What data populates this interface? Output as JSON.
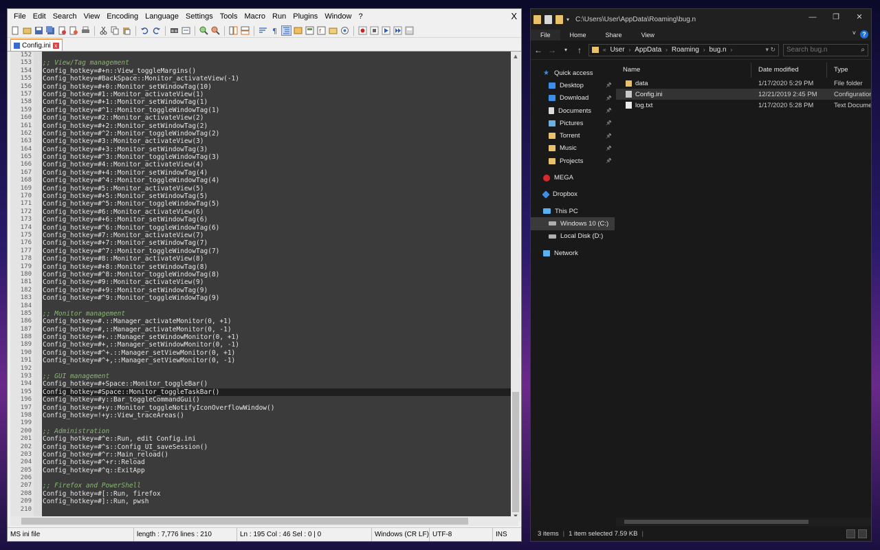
{
  "npp": {
    "menu": [
      "File",
      "Edit",
      "Search",
      "View",
      "Encoding",
      "Language",
      "Settings",
      "Tools",
      "Macro",
      "Run",
      "Plugins",
      "Window",
      "?"
    ],
    "close": "X",
    "tab": {
      "label": "Config.ini",
      "close": "x"
    },
    "code": [
      {
        "n": "152",
        "t": ""
      },
      {
        "n": "153",
        "t": ";; View/Tag management",
        "c": true
      },
      {
        "n": "154",
        "t": "Config_hotkey=#+n::View_toggleMargins()"
      },
      {
        "n": "155",
        "t": "Config_hotkey=#BackSpace::Monitor_activateView(-1)"
      },
      {
        "n": "156",
        "t": "Config_hotkey=#+0::Monitor_setWindowTag(10)"
      },
      {
        "n": "157",
        "t": "Config_hotkey=#1::Monitor_activateView(1)"
      },
      {
        "n": "158",
        "t": "Config_hotkey=#+1::Monitor_setWindowTag(1)"
      },
      {
        "n": "159",
        "t": "Config_hotkey=#^1::Monitor_toggleWindowTag(1)"
      },
      {
        "n": "160",
        "t": "Config_hotkey=#2::Monitor_activateView(2)"
      },
      {
        "n": "161",
        "t": "Config_hotkey=#+2::Monitor_setWindowTag(2)"
      },
      {
        "n": "162",
        "t": "Config_hotkey=#^2::Monitor_toggleWindowTag(2)"
      },
      {
        "n": "163",
        "t": "Config_hotkey=#3::Monitor_activateView(3)"
      },
      {
        "n": "164",
        "t": "Config_hotkey=#+3::Monitor_setWindowTag(3)"
      },
      {
        "n": "165",
        "t": "Config_hotkey=#^3::Monitor_toggleWindowTag(3)"
      },
      {
        "n": "166",
        "t": "Config_hotkey=#4::Monitor_activateView(4)"
      },
      {
        "n": "167",
        "t": "Config_hotkey=#+4::Monitor_setWindowTag(4)"
      },
      {
        "n": "168",
        "t": "Config_hotkey=#^4::Monitor_toggleWindowTag(4)"
      },
      {
        "n": "169",
        "t": "Config_hotkey=#5::Monitor_activateView(5)"
      },
      {
        "n": "170",
        "t": "Config_hotkey=#+5::Monitor_setWindowTag(5)"
      },
      {
        "n": "171",
        "t": "Config_hotkey=#^5::Monitor_toggleWindowTag(5)"
      },
      {
        "n": "172",
        "t": "Config_hotkey=#6::Monitor_activateView(6)"
      },
      {
        "n": "173",
        "t": "Config_hotkey=#+6::Monitor_setWindowTag(6)"
      },
      {
        "n": "174",
        "t": "Config_hotkey=#^6::Monitor_toggleWindowTag(6)"
      },
      {
        "n": "175",
        "t": "Config_hotkey=#7::Monitor_activateView(7)"
      },
      {
        "n": "176",
        "t": "Config_hotkey=#+7::Monitor_setWindowTag(7)"
      },
      {
        "n": "177",
        "t": "Config_hotkey=#^7::Monitor_toggleWindowTag(7)"
      },
      {
        "n": "178",
        "t": "Config_hotkey=#8::Monitor_activateView(8)"
      },
      {
        "n": "179",
        "t": "Config_hotkey=#+8::Monitor_setWindowTag(8)"
      },
      {
        "n": "180",
        "t": "Config_hotkey=#^8::Monitor_toggleWindowTag(8)"
      },
      {
        "n": "181",
        "t": "Config_hotkey=#9::Monitor_activateView(9)"
      },
      {
        "n": "182",
        "t": "Config_hotkey=#+9::Monitor_setWindowTag(9)"
      },
      {
        "n": "183",
        "t": "Config_hotkey=#^9::Monitor_toggleWindowTag(9)"
      },
      {
        "n": "184",
        "t": ""
      },
      {
        "n": "185",
        "t": ";; Monitor management",
        "c": true
      },
      {
        "n": "186",
        "t": "Config_hotkey=#.::Manager_activateMonitor(0, +1)"
      },
      {
        "n": "187",
        "t": "Config_hotkey=#,::Manager_activateMonitor(0, -1)"
      },
      {
        "n": "188",
        "t": "Config_hotkey=#+.::Manager_setWindowMonitor(0, +1)"
      },
      {
        "n": "189",
        "t": "Config_hotkey=#+,::Manager_setWindowMonitor(0, -1)"
      },
      {
        "n": "190",
        "t": "Config_hotkey=#^+.::Manager_setViewMonitor(0, +1)"
      },
      {
        "n": "191",
        "t": "Config_hotkey=#^+,::Manager_setViewMonitor(0, -1)"
      },
      {
        "n": "192",
        "t": ""
      },
      {
        "n": "193",
        "t": ";; GUI management",
        "c": true
      },
      {
        "n": "194",
        "t": "Config_hotkey=#+Space::Monitor_toggleBar()"
      },
      {
        "n": "195",
        "t": "Config_hotkey=#Space::Monitor_toggleTaskBar()",
        "cur": true
      },
      {
        "n": "196",
        "t": "Config_hotkey=#y::Bar_toggleCommandGui()"
      },
      {
        "n": "197",
        "t": "Config_hotkey=#+y::Monitor_toggleNotifyIconOverflowWindow()"
      },
      {
        "n": "198",
        "t": "Config_hotkey=!+y::View_traceAreas()"
      },
      {
        "n": "199",
        "t": ""
      },
      {
        "n": "200",
        "t": ";; Administration",
        "c": true
      },
      {
        "n": "201",
        "t": "Config_hotkey=#^e::Run, edit Config.ini"
      },
      {
        "n": "202",
        "t": "Config_hotkey=#^s::Config_UI_saveSession()"
      },
      {
        "n": "203",
        "t": "Config_hotkey=#^r::Main_reload()"
      },
      {
        "n": "204",
        "t": "Config_hotkey=#^+r::Reload"
      },
      {
        "n": "205",
        "t": "Config_hotkey=#^q::ExitApp"
      },
      {
        "n": "206",
        "t": ""
      },
      {
        "n": "207",
        "t": ";; Firefox and PowerShell",
        "c": true
      },
      {
        "n": "208",
        "t": "Config_hotkey=#[::Run, firefox"
      },
      {
        "n": "209",
        "t": "Config_hotkey=#]::Run, pwsh"
      },
      {
        "n": "210",
        "t": ""
      }
    ],
    "status": {
      "type": "MS ini file",
      "length": "length : 7,776    lines : 210",
      "pos": "Ln : 195    Col : 46    Sel : 0 | 0",
      "eol": "Windows (CR LF)",
      "enc": "UTF-8",
      "ins": "INS"
    }
  },
  "explorer": {
    "title_path": "C:\\Users\\User\\AppData\\Roaming\\bug.n",
    "ribbon": [
      "File",
      "Home",
      "Share",
      "View"
    ],
    "help": "?",
    "breadcrumbs": [
      "User",
      "AppData",
      "Roaming",
      "bug.n"
    ],
    "search_placeholder": "Search bug.n",
    "nav": [
      {
        "label": "Quick access",
        "icon": "star",
        "sub": false
      },
      {
        "label": "Desktop",
        "icon": "blue",
        "sub": true,
        "pin": true
      },
      {
        "label": "Download",
        "icon": "blue",
        "sub": true,
        "pin": true
      },
      {
        "label": "Documents",
        "icon": "doc",
        "sub": true,
        "pin": true
      },
      {
        "label": "Pictures",
        "icon": "pic",
        "sub": true,
        "pin": true
      },
      {
        "label": "Torrent",
        "icon": "folder",
        "sub": true,
        "pin": true
      },
      {
        "label": "Music",
        "icon": "folder",
        "sub": true,
        "pin": true
      },
      {
        "label": "Projects",
        "icon": "folder",
        "sub": true,
        "pin": true
      },
      {
        "gap": true
      },
      {
        "label": "MEGA",
        "icon": "mega",
        "sub": false
      },
      {
        "gap": true
      },
      {
        "label": "Dropbox",
        "icon": "dropbox",
        "sub": false
      },
      {
        "gap": true
      },
      {
        "label": "This PC",
        "icon": "pc",
        "sub": false
      },
      {
        "label": "Windows 10 (C:)",
        "icon": "drive",
        "sub": true,
        "selected": true
      },
      {
        "label": "Local Disk (D:)",
        "icon": "drive",
        "sub": true
      },
      {
        "gap": true
      },
      {
        "label": "Network",
        "icon": "net",
        "sub": false
      }
    ],
    "columns": [
      "Name",
      "Date modified",
      "Type"
    ],
    "files": [
      {
        "name": "data",
        "date": "1/17/2020 5:29 PM",
        "type": "File folder",
        "icon": "folder"
      },
      {
        "name": "Config.ini",
        "date": "12/21/2019 2:45 PM",
        "type": "Configuration",
        "icon": "ini",
        "selected": true
      },
      {
        "name": "log.txt",
        "date": "1/17/2020 5:28 PM",
        "type": "Text Document",
        "icon": "txt"
      }
    ],
    "status": {
      "items": "3 items",
      "selected": "1 item selected  7.59 KB"
    }
  }
}
